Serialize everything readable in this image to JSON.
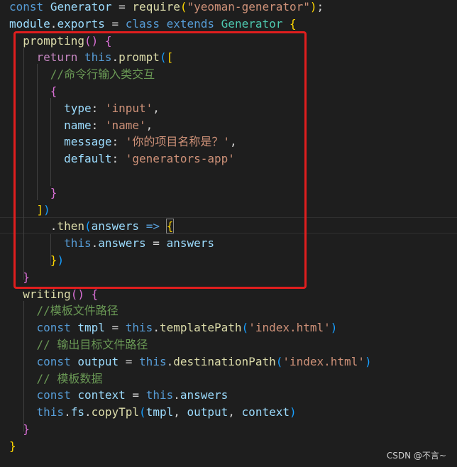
{
  "editor": {
    "lines": [
      {
        "tokens": [
          [
            "const",
            "kw-blue"
          ],
          [
            " ",
            "plain"
          ],
          [
            "Generator",
            "var"
          ],
          [
            " = ",
            "plain"
          ],
          [
            "require",
            "fn"
          ],
          [
            "(",
            "b1"
          ],
          [
            "\"yeoman-generator\"",
            "str"
          ],
          [
            ")",
            "b1"
          ],
          [
            ";",
            "plain"
          ]
        ]
      },
      {
        "tokens": [
          [
            "module",
            "var"
          ],
          [
            ".",
            "plain"
          ],
          [
            "exports",
            "var"
          ],
          [
            " = ",
            "plain"
          ],
          [
            "class",
            "kw-blue"
          ],
          [
            " ",
            "plain"
          ],
          [
            "extends",
            "kw-blue"
          ],
          [
            " ",
            "plain"
          ],
          [
            "Generator",
            "class"
          ],
          [
            " ",
            "plain"
          ],
          [
            "{",
            "b1"
          ]
        ]
      },
      {
        "tokens": [
          [
            "  ",
            "plain"
          ],
          [
            "prompting",
            "fn"
          ],
          [
            "()",
            "b2"
          ],
          [
            " ",
            "plain"
          ],
          [
            "{",
            "b2"
          ]
        ]
      },
      {
        "tokens": [
          [
            "    ",
            "plain"
          ],
          [
            "return",
            "kw-purple"
          ],
          [
            " ",
            "plain"
          ],
          [
            "this",
            "kw-blue"
          ],
          [
            ".",
            "plain"
          ],
          [
            "prompt",
            "fn"
          ],
          [
            "(",
            "b3"
          ],
          [
            "[",
            "b1"
          ]
        ]
      },
      {
        "tokens": [
          [
            "      ",
            "plain"
          ],
          [
            "//命令行输入类交互",
            "comment"
          ]
        ]
      },
      {
        "tokens": [
          [
            "      ",
            "plain"
          ],
          [
            "{",
            "b2"
          ]
        ]
      },
      {
        "tokens": [
          [
            "        ",
            "plain"
          ],
          [
            "type",
            "var"
          ],
          [
            ": ",
            "plain"
          ],
          [
            "'input'",
            "str"
          ],
          [
            ",",
            "plain"
          ]
        ]
      },
      {
        "tokens": [
          [
            "        ",
            "plain"
          ],
          [
            "name",
            "var"
          ],
          [
            ": ",
            "plain"
          ],
          [
            "'name'",
            "str"
          ],
          [
            ",",
            "plain"
          ]
        ]
      },
      {
        "tokens": [
          [
            "        ",
            "plain"
          ],
          [
            "message",
            "var"
          ],
          [
            ": ",
            "plain"
          ],
          [
            "'你的项目名称是？'",
            "str"
          ],
          [
            ",",
            "plain"
          ]
        ]
      },
      {
        "tokens": [
          [
            "        ",
            "plain"
          ],
          [
            "default",
            "var"
          ],
          [
            ": ",
            "plain"
          ],
          [
            "'generators-app'",
            "str"
          ]
        ]
      },
      {
        "tokens": []
      },
      {
        "tokens": [
          [
            "      ",
            "plain"
          ],
          [
            "}",
            "b2"
          ]
        ]
      },
      {
        "tokens": [
          [
            "    ",
            "plain"
          ],
          [
            "]",
            "b1"
          ],
          [
            ")",
            "b3"
          ]
        ]
      },
      {
        "tokens": [
          [
            "      ",
            "plain"
          ],
          [
            ".",
            "plain"
          ],
          [
            "then",
            "fn"
          ],
          [
            "(",
            "b3"
          ],
          [
            "answers",
            "var"
          ],
          [
            " ",
            "plain"
          ],
          [
            "=>",
            "kw-blue"
          ],
          [
            " ",
            "plain"
          ],
          [
            "{",
            "b1"
          ]
        ]
      },
      {
        "tokens": [
          [
            "        ",
            "plain"
          ],
          [
            "this",
            "kw-blue"
          ],
          [
            ".",
            "plain"
          ],
          [
            "answers",
            "var"
          ],
          [
            " = ",
            "plain"
          ],
          [
            "answers",
            "var"
          ]
        ]
      },
      {
        "tokens": [
          [
            "      ",
            "plain"
          ],
          [
            "}",
            "b1"
          ],
          [
            ")",
            "b3"
          ]
        ]
      },
      {
        "tokens": [
          [
            "  ",
            "plain"
          ],
          [
            "}",
            "b2"
          ]
        ]
      },
      {
        "tokens": [
          [
            "  ",
            "plain"
          ],
          [
            "writing",
            "fn"
          ],
          [
            "()",
            "b2"
          ],
          [
            " ",
            "plain"
          ],
          [
            "{",
            "b2"
          ]
        ]
      },
      {
        "tokens": [
          [
            "    ",
            "plain"
          ],
          [
            "//模板文件路径",
            "comment"
          ]
        ]
      },
      {
        "tokens": [
          [
            "    ",
            "plain"
          ],
          [
            "const",
            "kw-blue"
          ],
          [
            " ",
            "plain"
          ],
          [
            "tmpl",
            "var"
          ],
          [
            " = ",
            "plain"
          ],
          [
            "this",
            "kw-blue"
          ],
          [
            ".",
            "plain"
          ],
          [
            "templatePath",
            "fn"
          ],
          [
            "(",
            "b3"
          ],
          [
            "'index.html'",
            "str"
          ],
          [
            ")",
            "b3"
          ]
        ]
      },
      {
        "tokens": [
          [
            "    ",
            "plain"
          ],
          [
            "// 输出目标文件路径",
            "comment"
          ]
        ]
      },
      {
        "tokens": [
          [
            "    ",
            "plain"
          ],
          [
            "const",
            "kw-blue"
          ],
          [
            " ",
            "plain"
          ],
          [
            "output",
            "var"
          ],
          [
            " = ",
            "plain"
          ],
          [
            "this",
            "kw-blue"
          ],
          [
            ".",
            "plain"
          ],
          [
            "destinationPath",
            "fn"
          ],
          [
            "(",
            "b3"
          ],
          [
            "'index.html'",
            "str"
          ],
          [
            ")",
            "b3"
          ]
        ]
      },
      {
        "tokens": [
          [
            "    ",
            "plain"
          ],
          [
            "// 模板数据",
            "comment"
          ]
        ]
      },
      {
        "tokens": [
          [
            "    ",
            "plain"
          ],
          [
            "const",
            "kw-blue"
          ],
          [
            " ",
            "plain"
          ],
          [
            "context",
            "var"
          ],
          [
            " = ",
            "plain"
          ],
          [
            "this",
            "kw-blue"
          ],
          [
            ".",
            "plain"
          ],
          [
            "answers",
            "var"
          ]
        ]
      },
      {
        "tokens": [
          [
            "    ",
            "plain"
          ],
          [
            "this",
            "kw-blue"
          ],
          [
            ".",
            "plain"
          ],
          [
            "fs",
            "var"
          ],
          [
            ".",
            "plain"
          ],
          [
            "copyTpl",
            "fn"
          ],
          [
            "(",
            "b3"
          ],
          [
            "tmpl",
            "var"
          ],
          [
            ", ",
            "plain"
          ],
          [
            "output",
            "var"
          ],
          [
            ", ",
            "plain"
          ],
          [
            "context",
            "var"
          ],
          [
            ")",
            "b3"
          ]
        ]
      },
      {
        "tokens": [
          [
            "  ",
            "plain"
          ],
          [
            "}",
            "b2"
          ]
        ]
      },
      {
        "tokens": [
          [
            "}",
            "b1"
          ]
        ]
      }
    ]
  },
  "watermark": "CSDN @不言~",
  "colors": {
    "background": "#1e1e1e",
    "highlight_box": "#e01e1e"
  }
}
